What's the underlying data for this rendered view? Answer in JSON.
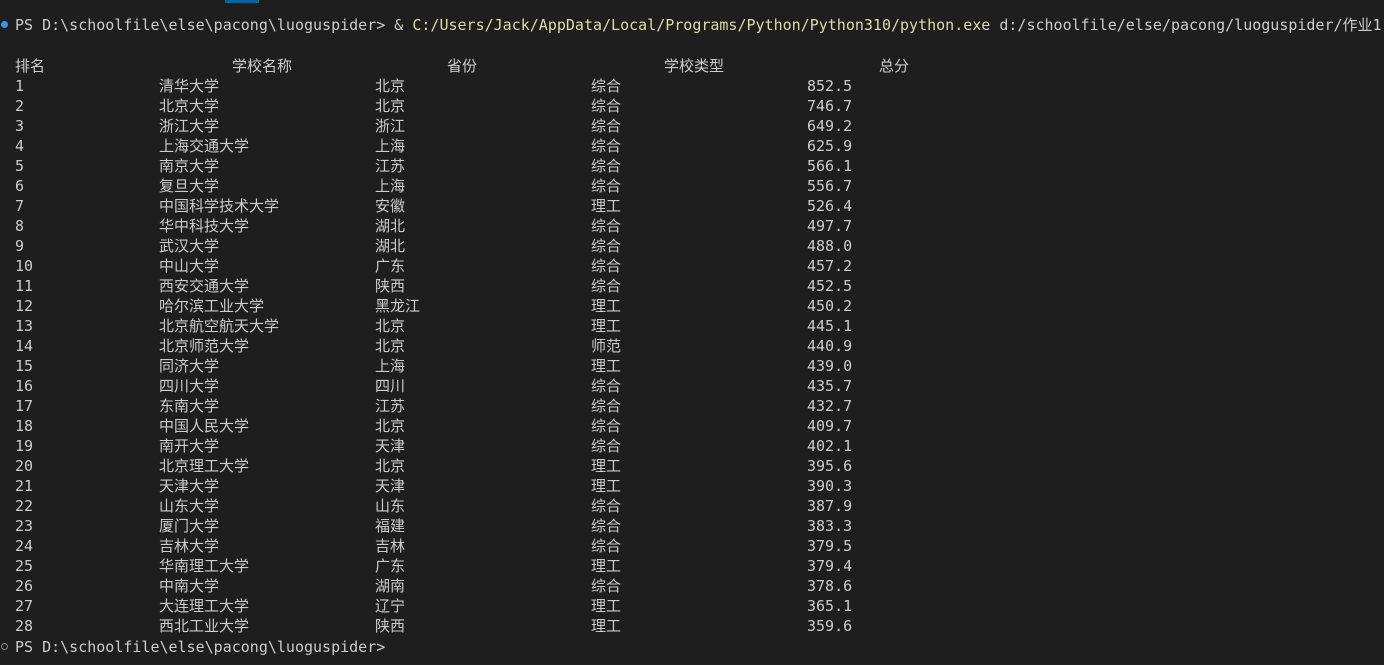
{
  "terminal": {
    "prompt": "PS D:\\schoolfile\\else\\pacong\\luoguspider>",
    "amp": "&",
    "exe_path": "C:/Users/Jack/AppData/Local/Programs/Python/Python310/python.exe",
    "script_arg": "d:/schoolfile/else/pacong/luoguspider/作业1",
    "final_prompt": "PS D:\\schoolfile\\else\\pacong\\luoguspider>"
  },
  "table": {
    "headers": {
      "rank": "排名",
      "name": "学校名称",
      "province": "省份",
      "type": "学校类型",
      "score": "总分"
    },
    "rows": [
      {
        "rank": "1",
        "name": "清华大学",
        "province": "北京",
        "type": "综合",
        "score": "852.5"
      },
      {
        "rank": "2",
        "name": "北京大学",
        "province": "北京",
        "type": "综合",
        "score": "746.7"
      },
      {
        "rank": "3",
        "name": "浙江大学",
        "province": "浙江",
        "type": "综合",
        "score": "649.2"
      },
      {
        "rank": "4",
        "name": "上海交通大学",
        "province": "上海",
        "type": "综合",
        "score": "625.9"
      },
      {
        "rank": "5",
        "name": "南京大学",
        "province": "江苏",
        "type": "综合",
        "score": "566.1"
      },
      {
        "rank": "6",
        "name": "复旦大学",
        "province": "上海",
        "type": "综合",
        "score": "556.7"
      },
      {
        "rank": "7",
        "name": "中国科学技术大学",
        "province": "安徽",
        "type": "理工",
        "score": "526.4"
      },
      {
        "rank": "8",
        "name": "华中科技大学",
        "province": "湖北",
        "type": "综合",
        "score": "497.7"
      },
      {
        "rank": "9",
        "name": "武汉大学",
        "province": "湖北",
        "type": "综合",
        "score": "488.0"
      },
      {
        "rank": "10",
        "name": "中山大学",
        "province": "广东",
        "type": "综合",
        "score": "457.2"
      },
      {
        "rank": "11",
        "name": "西安交通大学",
        "province": "陕西",
        "type": "综合",
        "score": "452.5"
      },
      {
        "rank": "12",
        "name": "哈尔滨工业大学",
        "province": "黑龙江",
        "type": "理工",
        "score": "450.2"
      },
      {
        "rank": "13",
        "name": "北京航空航天大学",
        "province": "北京",
        "type": "理工",
        "score": "445.1"
      },
      {
        "rank": "14",
        "name": "北京师范大学",
        "province": "北京",
        "type": "师范",
        "score": "440.9"
      },
      {
        "rank": "15",
        "name": "同济大学",
        "province": "上海",
        "type": "理工",
        "score": "439.0"
      },
      {
        "rank": "16",
        "name": "四川大学",
        "province": "四川",
        "type": "综合",
        "score": "435.7"
      },
      {
        "rank": "17",
        "name": "东南大学",
        "province": "江苏",
        "type": "综合",
        "score": "432.7"
      },
      {
        "rank": "18",
        "name": "中国人民大学",
        "province": "北京",
        "type": "综合",
        "score": "409.7"
      },
      {
        "rank": "19",
        "name": "南开大学",
        "province": "天津",
        "type": "综合",
        "score": "402.1"
      },
      {
        "rank": "20",
        "name": "北京理工大学",
        "province": "北京",
        "type": "理工",
        "score": "395.6"
      },
      {
        "rank": "21",
        "name": "天津大学",
        "province": "天津",
        "type": "理工",
        "score": "390.3"
      },
      {
        "rank": "22",
        "name": "山东大学",
        "province": "山东",
        "type": "综合",
        "score": "387.9"
      },
      {
        "rank": "23",
        "name": "厦门大学",
        "province": "福建",
        "type": "综合",
        "score": "383.3"
      },
      {
        "rank": "24",
        "name": "吉林大学",
        "province": "吉林",
        "type": "综合",
        "score": "379.5"
      },
      {
        "rank": "25",
        "name": "华南理工大学",
        "province": "广东",
        "type": "理工",
        "score": "379.4"
      },
      {
        "rank": "26",
        "name": "中南大学",
        "province": "湖南",
        "type": "综合",
        "score": "378.6"
      },
      {
        "rank": "27",
        "name": "大连理工大学",
        "province": "辽宁",
        "type": "理工",
        "score": "365.1"
      },
      {
        "rank": "28",
        "name": "西北工业大学",
        "province": "陕西",
        "type": "理工",
        "score": "359.6"
      }
    ]
  },
  "colors": {
    "background": "#1e1e1e",
    "text": "#cccccc",
    "exe_highlight": "#dcdcaa",
    "success_dot": "#3794ff"
  }
}
